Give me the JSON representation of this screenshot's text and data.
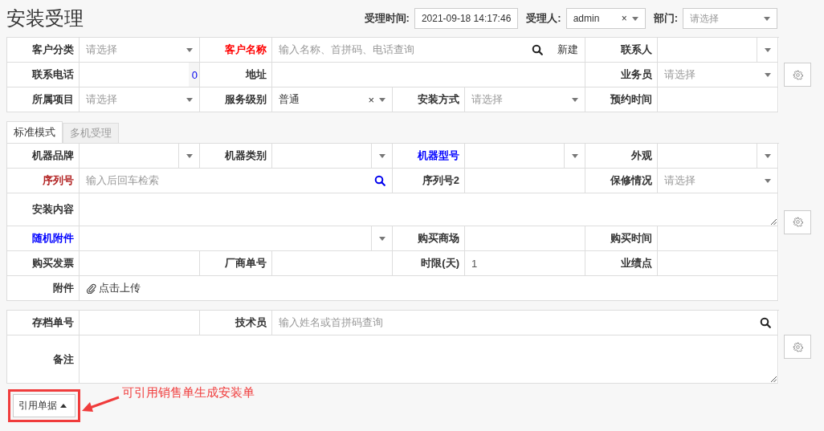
{
  "title": "安装受理",
  "header_fields": [
    {
      "label": "受理时间:",
      "kind": "text",
      "value": "2021-09-18 14:17:46"
    },
    {
      "label": "受理人:",
      "kind": "select",
      "value": "admin",
      "clear": "×"
    },
    {
      "label": "部门:",
      "kind": "select",
      "placeholder": "请选择"
    }
  ],
  "sections": [
    {
      "rows": [
        [
          {
            "label": "客户分类",
            "control": {
              "kind": "select",
              "placeholder": "请选择"
            }
          },
          {
            "label": "客户名称",
            "color": "#ff0000",
            "control": {
              "kind": "search",
              "placeholder": "输入名称、首拼码、电话查询",
              "highlighted": false,
              "action": "新建"
            }
          },
          {
            "label": "联系人",
            "control": {
              "kind": "combo"
            }
          }
        ],
        [
          {
            "label": "联系电话",
            "control": {
              "kind": "count",
              "value": "0"
            }
          },
          {
            "label": "地址",
            "control": {
              "kind": "text"
            }
          },
          {
            "label": "业务员",
            "control": {
              "kind": "select",
              "placeholder": "请选择"
            }
          }
        ],
        [
          {
            "label": "所属项目",
            "control": {
              "kind": "select",
              "placeholder": "请选择"
            }
          },
          {
            "label": "服务级别",
            "control": {
              "kind": "select",
              "value": "普通",
              "clear": "×"
            }
          },
          {
            "label": "安装方式",
            "control": {
              "kind": "select",
              "placeholder": "请选择"
            }
          },
          {
            "label": "预约时间",
            "control": {
              "kind": "text"
            }
          }
        ]
      ]
    },
    {
      "tabs": [
        {
          "label": "标准模式",
          "selected": true
        },
        {
          "label": "多机受理",
          "selected": false
        }
      ],
      "rows": [
        [
          {
            "label": "机器品牌",
            "control": {
              "kind": "combo"
            }
          },
          {
            "label": "机器类别",
            "control": {
              "kind": "combo"
            }
          },
          {
            "label": "机器型号",
            "color": "#0000ff",
            "control": {
              "kind": "combo"
            }
          },
          {
            "label": "外观",
            "control": {
              "kind": "combo"
            }
          }
        ],
        [
          {
            "label": "序列号",
            "color": "#b22222",
            "control": {
              "kind": "search",
              "placeholder": "输入后回车检索",
              "highlighted": true
            }
          },
          {
            "label": "序列号2",
            "control": {
              "kind": "text"
            }
          },
          {
            "label": "保修情况",
            "control": {
              "kind": "select",
              "placeholder": "请选择"
            }
          }
        ],
        [
          {
            "label": "安装内容",
            "control": {
              "kind": "textarea"
            }
          }
        ],
        [
          {
            "label": "随机附件",
            "color": "#0000ff",
            "control": {
              "kind": "combo"
            }
          },
          {
            "label": "购买商场",
            "control": {
              "kind": "text"
            }
          },
          {
            "label": "购买时间",
            "control": {
              "kind": "text"
            }
          }
        ],
        [
          {
            "label": "购买发票",
            "control": {
              "kind": "text"
            }
          },
          {
            "label": "厂商单号",
            "control": {
              "kind": "text"
            }
          },
          {
            "label": "时限(天)",
            "control": {
              "kind": "text",
              "value": "1"
            }
          },
          {
            "label": "业绩点",
            "control": {
              "kind": "text"
            }
          }
        ],
        [
          {
            "label": "附件",
            "control": {
              "kind": "upload",
              "text": "点击上传"
            }
          }
        ]
      ]
    },
    {
      "rows": [
        [
          {
            "label": "存档单号",
            "control": {
              "kind": "text"
            }
          },
          {
            "label": "技术员",
            "control": {
              "kind": "search",
              "placeholder": "输入姓名或首拼码查询",
              "highlighted": false
            }
          }
        ],
        [
          {
            "label": "备注",
            "control": {
              "kind": "memo"
            }
          }
        ]
      ]
    }
  ],
  "reference_button": {
    "label": "引用单据",
    "highlighted": true
  },
  "annotation": "可引用销售单生成安装单"
}
